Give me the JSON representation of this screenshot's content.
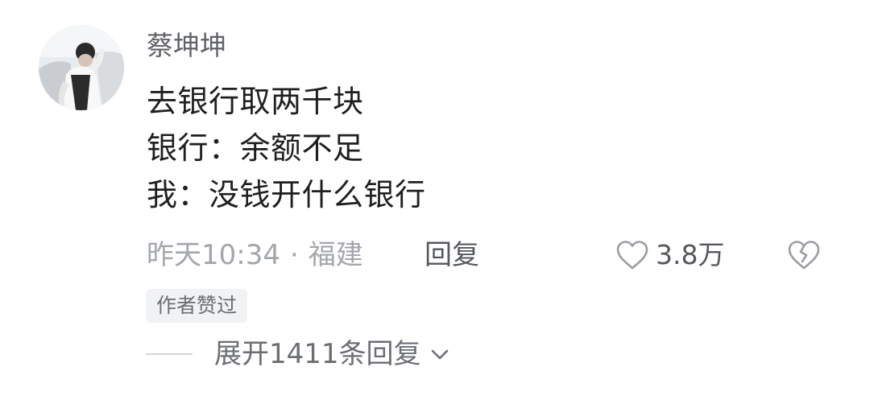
{
  "comment": {
    "username": "蔡坤坤",
    "lines": [
      "去银行取两千块",
      "银行：余额不足",
      "我：没钱开什么银行"
    ],
    "time": "昨天10:34",
    "separator": "·",
    "location": "福建",
    "reply_label": "回复",
    "like_count": "3.8万",
    "author_badge": "作者赞过",
    "expand_label": "展开1411条回复"
  },
  "icons": {
    "avatar": "avatar-photo",
    "like": "heart-outline-icon",
    "dislike": "broken-heart-outline-icon",
    "expand": "chevron-down-icon"
  },
  "colors": {
    "text_primary": "#1f1f1f",
    "text_secondary": "#a3a6ab",
    "username": "#5f6266",
    "badge_bg": "#f1f2f4"
  }
}
